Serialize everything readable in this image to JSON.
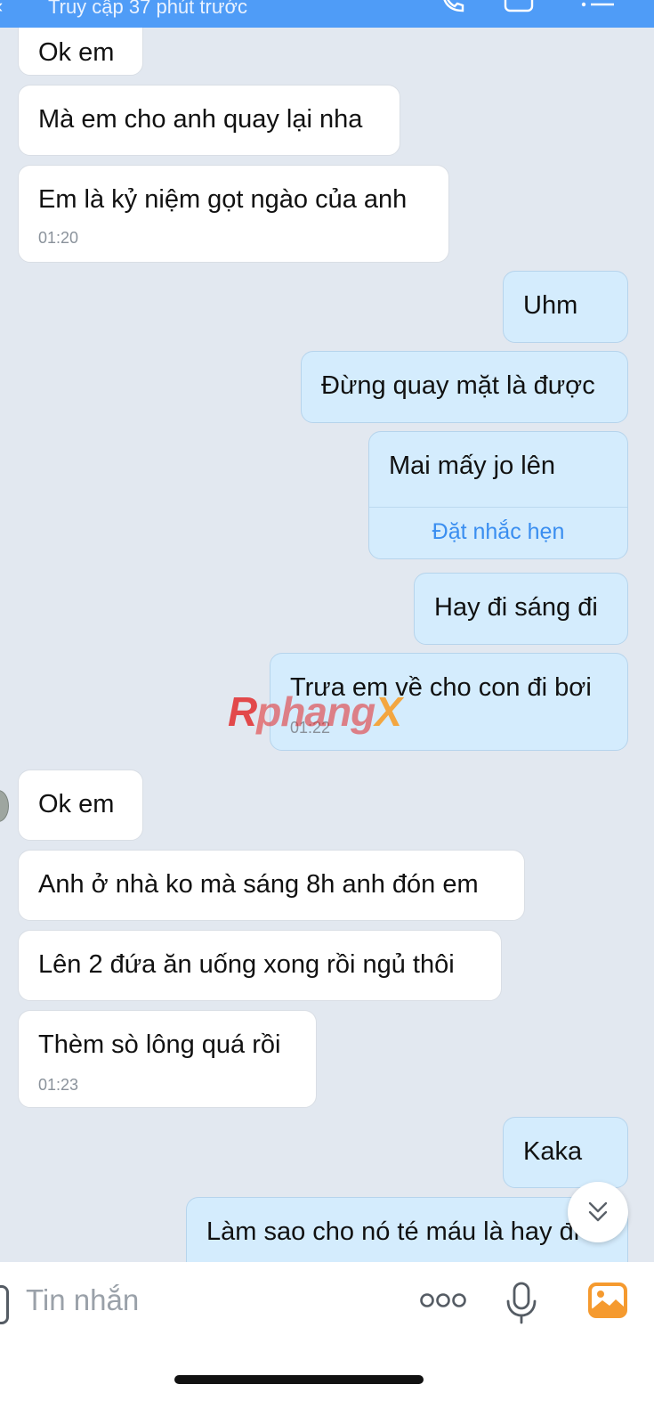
{
  "header": {
    "subtitle": "Truy cập 37 phút trước",
    "back_icon": "chevron-left-icon",
    "call_icon": "phone-icon",
    "video_icon": "video-icon",
    "menu_icon": "list-icon"
  },
  "messages": [
    {
      "dir": "in",
      "text": "Ok em"
    },
    {
      "dir": "in",
      "text": "Mà em cho anh quay lại nha"
    },
    {
      "dir": "in",
      "text": "Em là kỷ niệm gọt ngào của anh",
      "time": "01:20"
    },
    {
      "dir": "out",
      "text": "Uhm"
    },
    {
      "dir": "out",
      "text": "Đừng quay mặt là được"
    },
    {
      "dir": "out",
      "text": "Mai mấy jo lên",
      "action": "Đặt nhắc hẹn"
    },
    {
      "dir": "out",
      "text": "Hay đi sáng đi"
    },
    {
      "dir": "out",
      "text": "Trưa em về cho con đi bơi",
      "time": "01:22"
    },
    {
      "dir": "in",
      "text": "Ok em"
    },
    {
      "dir": "in",
      "text": "Anh ở nhà ko mà sáng 8h anh đón em"
    },
    {
      "dir": "in",
      "text": "Lên 2 đứa ăn uống xong rồi ngủ thôi"
    },
    {
      "dir": "in",
      "text": "Thèm sò lông quá rồi",
      "time": "01:23"
    },
    {
      "dir": "out",
      "text": "Kaka"
    },
    {
      "dir": "out",
      "text": "Làm sao cho nó té máu là hay đi"
    }
  ],
  "watermark": {
    "first": "R",
    "middle": "phang",
    "last": "X"
  },
  "composer": {
    "placeholder": "Tin nhắn",
    "sticker_icon": "sticker-icon",
    "more_icon": "more-dots-icon",
    "mic_icon": "microphone-icon",
    "photo_icon": "photo-icon"
  },
  "scroll_button_icon": "double-chevron-down-icon",
  "colors": {
    "header": "#4f9cf7",
    "chat_background": "#e2e8f0",
    "incoming_bubble": "#ffffff",
    "outgoing_bubble": "#d4ecfd",
    "link": "#3a8ef0",
    "photo_icon": "#f59a2f"
  }
}
